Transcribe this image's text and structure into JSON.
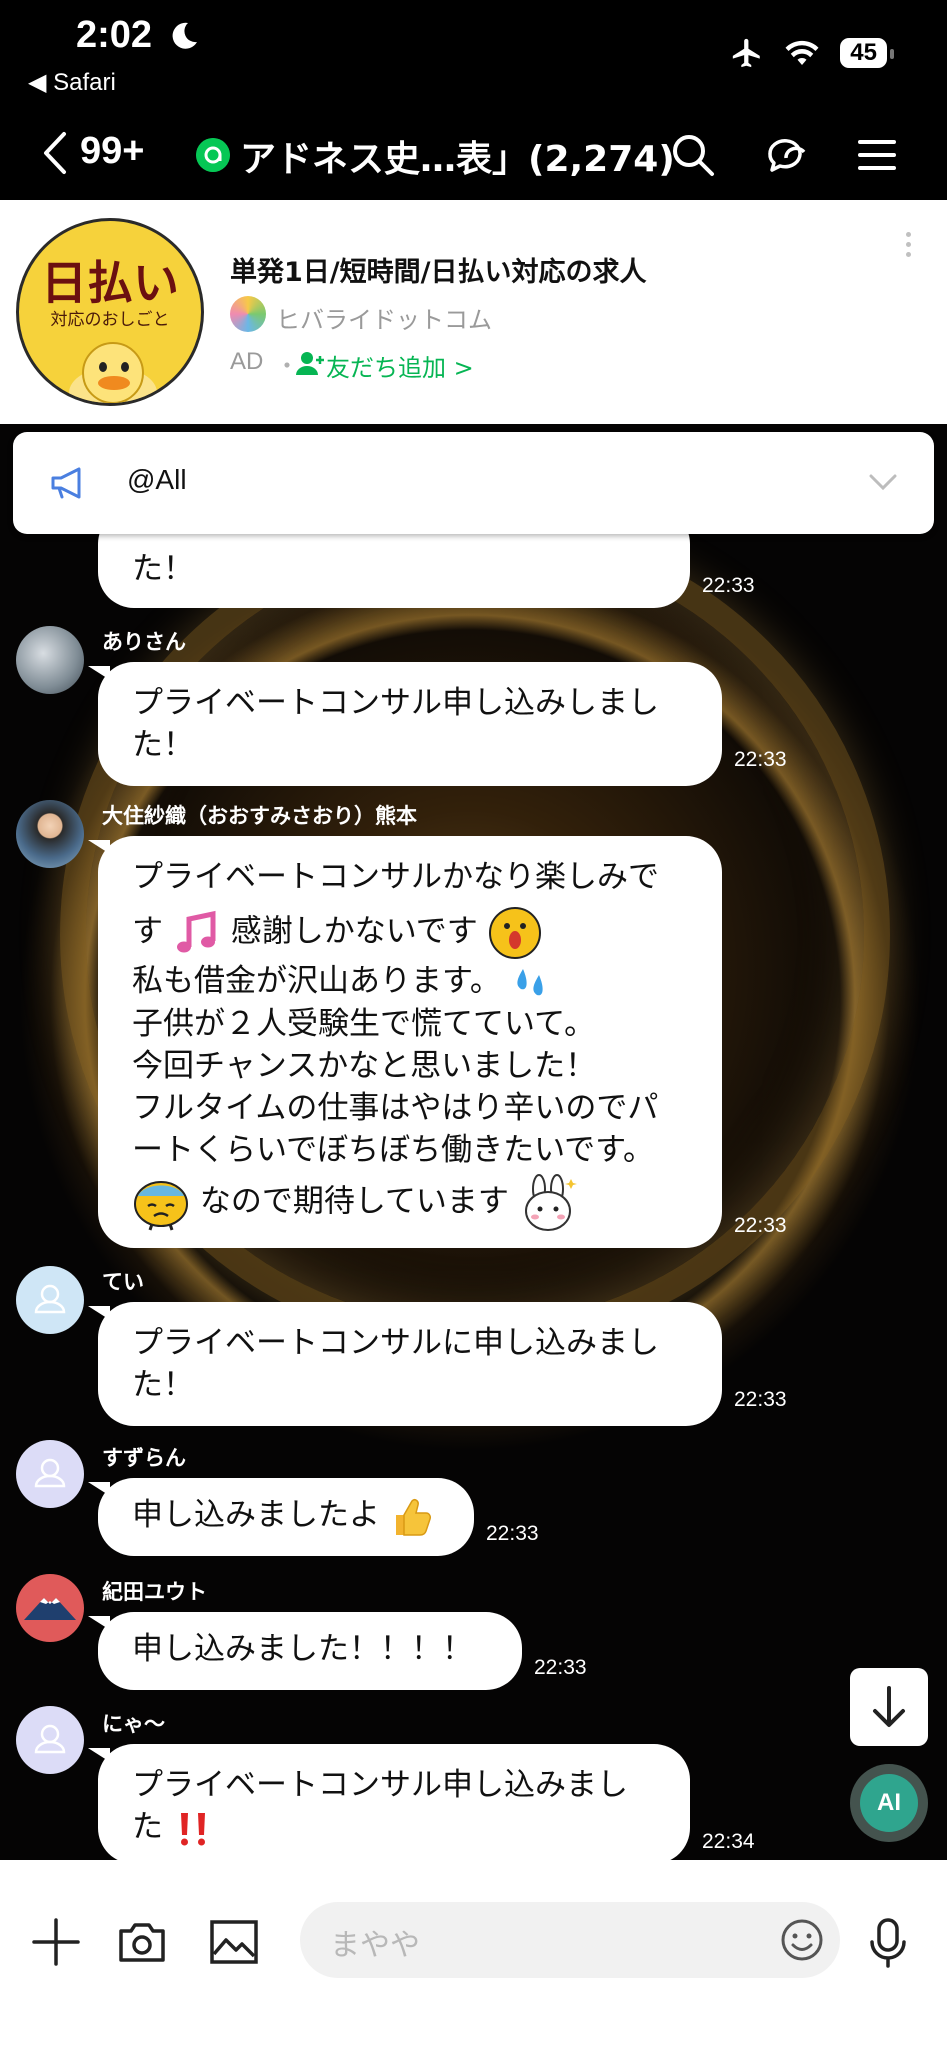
{
  "status_bar": {
    "time": "2:02",
    "back_app": "◀ Safari",
    "battery": "45"
  },
  "header": {
    "unread_count": "99+",
    "title": "アドネス史…表」(2,274)"
  },
  "ad": {
    "logo_main": "日払い",
    "logo_sub": "対応のおしごと",
    "title": "単発1日/短時間/日払い対応の求人",
    "provider": "ヒバライドットコム",
    "tag": "AD",
    "dot": "・",
    "add_friend": "友だち追加 >"
  },
  "announcement": {
    "text": "@All"
  },
  "messages": [
    {
      "sender": "",
      "lines": [
        "た！"
      ],
      "time": "22:33"
    },
    {
      "sender": "ありさん",
      "lines": [
        "プライベートコンサル申し込みしまし",
        "た！"
      ],
      "time": "22:33"
    },
    {
      "sender": "大住紗織（おおすみさおり）熊本",
      "lines": [
        "プライベートコンサルかなり楽しみで",
        "す",
        "感謝しかないです",
        "私も借金が沢山あります。",
        "子供が２人受験生で慌てていて。",
        "今回チャンスかなと思いました！",
        "フルタイムの仕事はやはり辛いのでパ",
        "ートくらいでぼちぼち働きたいです。",
        "なので期待しています"
      ],
      "time": "22:33"
    },
    {
      "sender": "てい",
      "lines": [
        "プライベートコンサルに申し込みまし",
        "た！"
      ],
      "time": "22:33"
    },
    {
      "sender": "すずらん",
      "lines": [
        "申し込みましたよ"
      ],
      "time": "22:33"
    },
    {
      "sender": "紀田ユウト",
      "lines": [
        "申し込みました！！！！"
      ],
      "time": "22:33"
    },
    {
      "sender": "にゃ〜",
      "lines": [
        "プライベートコンサル申し込みまし",
        "た"
      ],
      "time": "22:34"
    }
  ],
  "ai_button": "AI",
  "input": {
    "placeholder": "まやや"
  },
  "colors": {
    "line_green": "#06c755",
    "ai_teal": "#2fa58e",
    "bubble": "#ffffff"
  }
}
